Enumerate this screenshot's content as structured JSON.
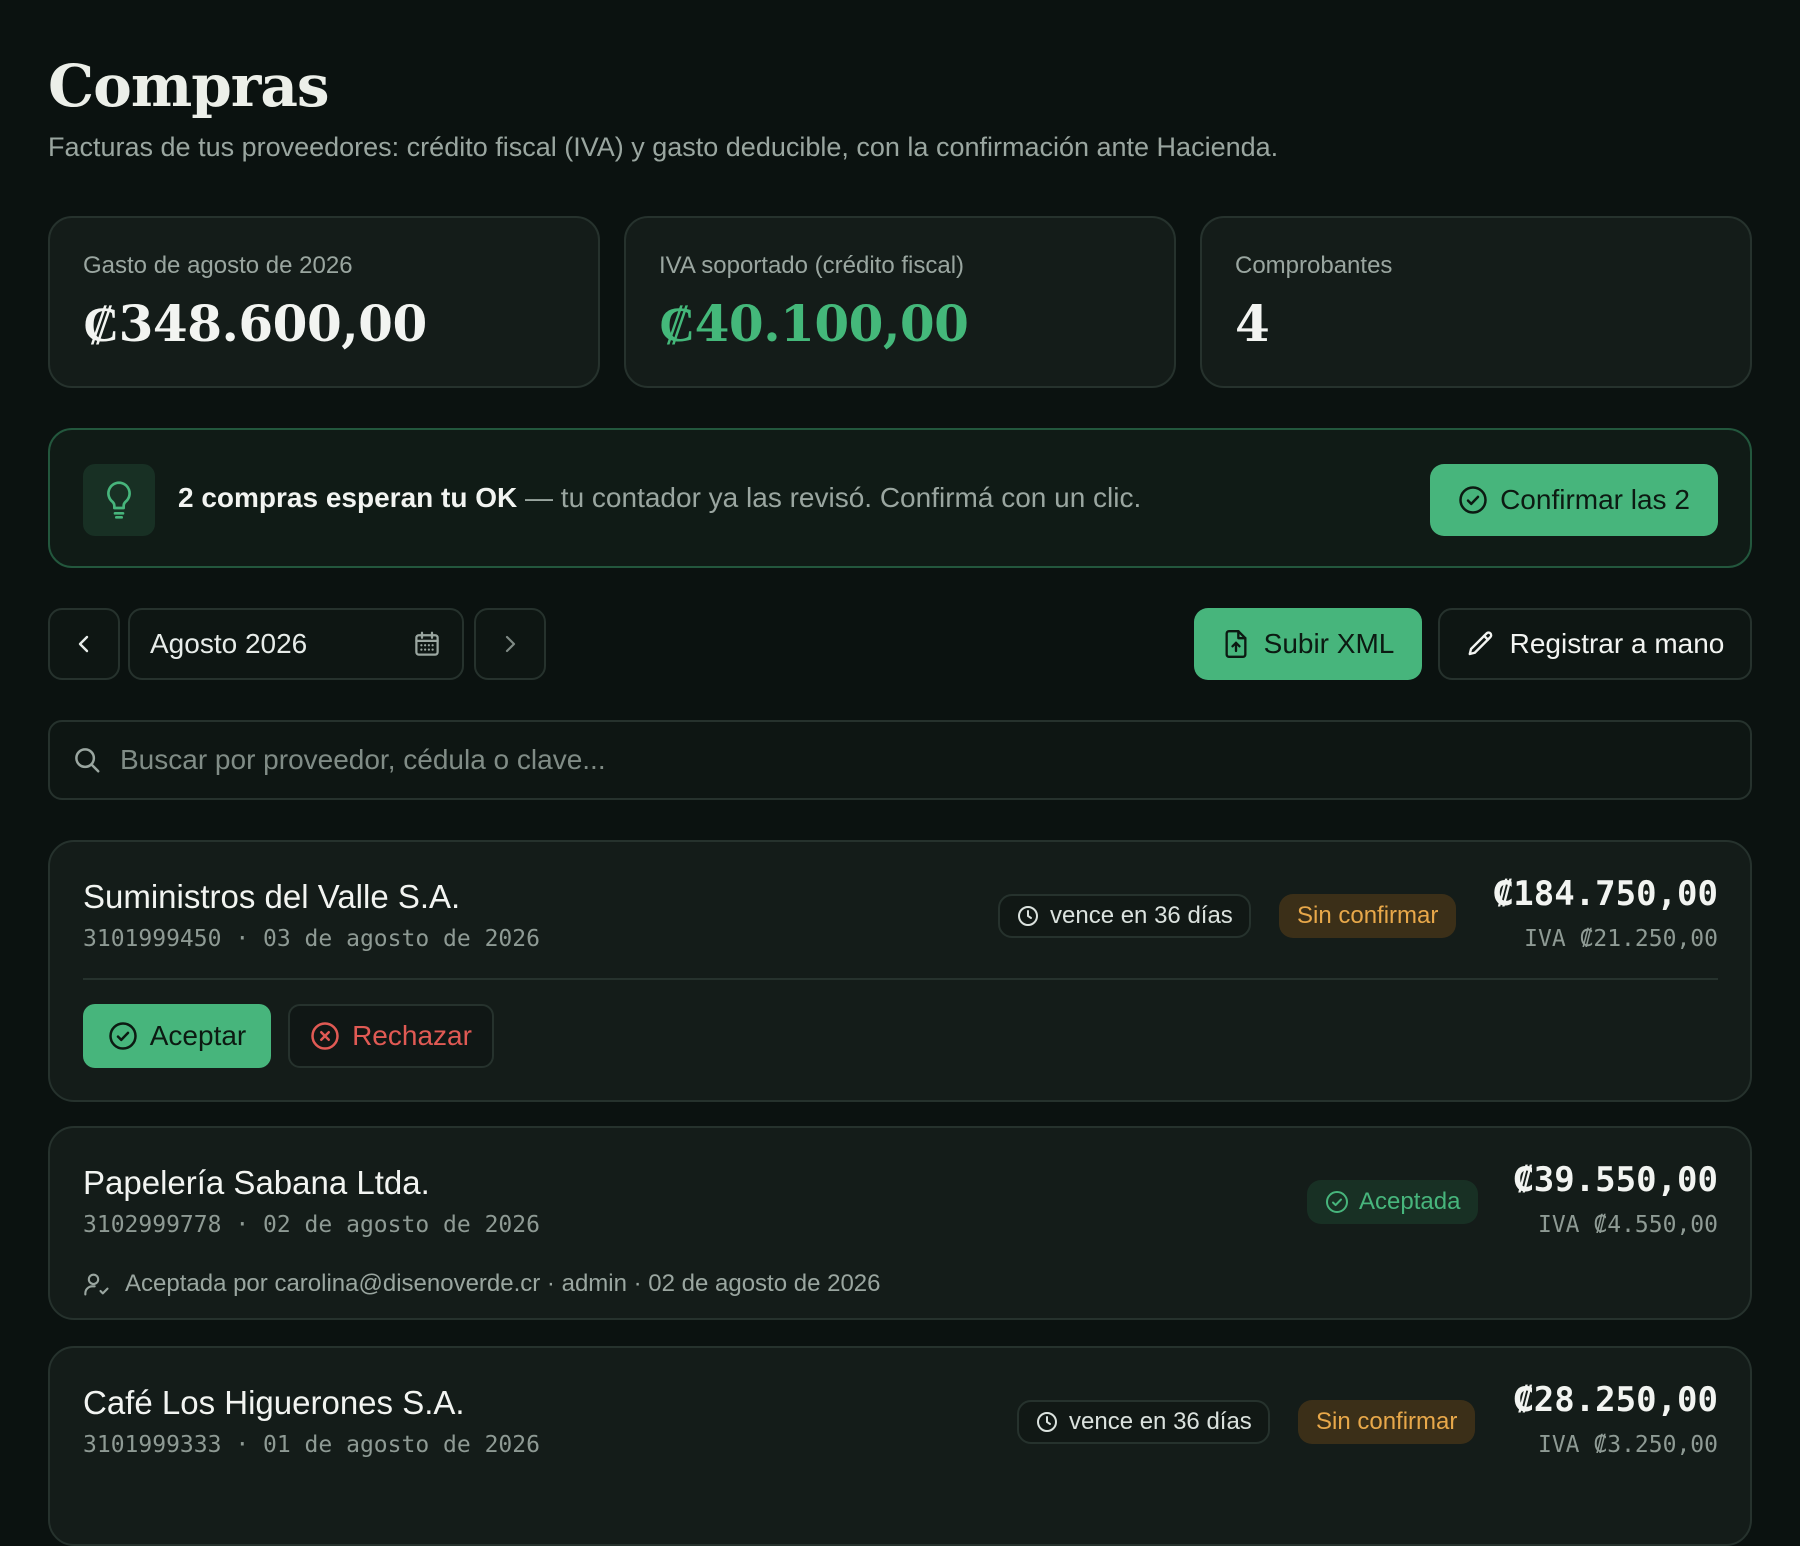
{
  "header": {
    "title": "Compras",
    "subtitle": "Facturas de tus proveedores: crédito fiscal (IVA) y gasto deducible, con la confirmación ante Hacienda."
  },
  "stats": [
    {
      "label": "Gasto de agosto de 2026",
      "value": "₡348.600,00"
    },
    {
      "label": "IVA soportado (crédito fiscal)",
      "value": "₡40.100,00"
    },
    {
      "label": "Comprobantes",
      "value": "4"
    }
  ],
  "callout": {
    "icon": "lightbulb-icon",
    "strong": "2 compras esperan tu OK",
    "rest": " — tu contador ya las revisó. Confirmá con un clic.",
    "button": "Confirmar las 2"
  },
  "toolbar": {
    "month": "Agosto 2026",
    "upload_label": "Subir XML",
    "manual_label": "Registrar a mano"
  },
  "search": {
    "placeholder": "Buscar por proveedor, cédula o clave..."
  },
  "invoices": [
    {
      "supplier": "Suministros del Valle S.A.",
      "meta": "3101999450 · 03 de agosto de 2026",
      "due": "vence en 36 días",
      "status": "Sin confirmar",
      "amount": "₡184.750,00",
      "iva": "IVA ₡21.250,00",
      "accept_label": "Aceptar",
      "reject_label": "Rechazar"
    },
    {
      "supplier": "Papelería Sabana Ltda.",
      "meta": "3102999778 · 02 de agosto de 2026",
      "status": "Aceptada",
      "amount": "₡39.550,00",
      "iva": "IVA ₡4.550,00",
      "accepted_by": "Aceptada por carolina@disenoverde.cr · admin · 02 de agosto de 2026"
    },
    {
      "supplier": "Café Los Higuerones S.A.",
      "meta": "3101999333 · 01 de agosto de 2026",
      "due": "vence en 36 días",
      "status": "Sin confirmar",
      "amount": "₡28.250,00",
      "iva": "IVA ₡3.250,00"
    }
  ],
  "colors": {
    "background": "#0b1210",
    "accent": "#47b57c",
    "pending": "#e8a84a",
    "danger": "#e05a54"
  }
}
